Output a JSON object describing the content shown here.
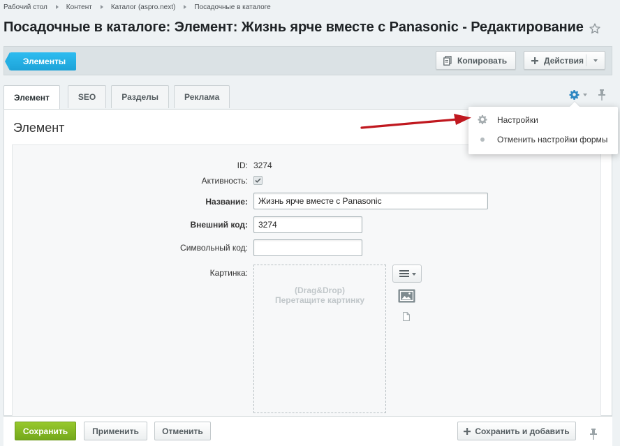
{
  "breadcrumb": [
    {
      "label": "Рабочий стол"
    },
    {
      "label": "Контент"
    },
    {
      "label": "Каталог (aspro.next)"
    },
    {
      "label": "Посадочные в каталоге"
    }
  ],
  "page": {
    "title": "Посадочные в каталоге: Элемент: Жизнь ярче вместе с Panasonic - Редактирование"
  },
  "toolbar": {
    "elements_label": "Элементы",
    "copy_label": "Копировать",
    "actions_label": "Действия"
  },
  "tabs": [
    {
      "label": "Элемент",
      "active": true
    },
    {
      "label": "SEO",
      "active": false
    },
    {
      "label": "Разделы",
      "active": false
    },
    {
      "label": "Реклама",
      "active": false
    }
  ],
  "settings_menu": {
    "items": [
      {
        "label": "Настройки",
        "icon": "gear-icon"
      },
      {
        "label": "Отменить настройки формы",
        "icon": "dot-icon"
      }
    ]
  },
  "form": {
    "section_title": "Элемент",
    "id_label": "ID:",
    "id_value": "3274",
    "active_label": "Активность:",
    "active_checked": true,
    "name_label": "Название:",
    "name_value": "Жизнь ярче вместе с Panasonic",
    "xml_id_label": "Внешний код:",
    "xml_id_value": "3274",
    "code_label": "Символьный код:",
    "code_value": "",
    "picture_label": "Картинка:",
    "dropzone_line1": "(Drag&Drop)",
    "dropzone_line2": "Перетащите картинку"
  },
  "footer": {
    "save_label": "Сохранить",
    "apply_label": "Применить",
    "cancel_label": "Отменить",
    "save_add_label": "Сохранить и добавить"
  },
  "colors": {
    "accent_blue": "#1da3d8",
    "save_green": "#7fb41f",
    "annotation_arrow": "#c0181f"
  }
}
